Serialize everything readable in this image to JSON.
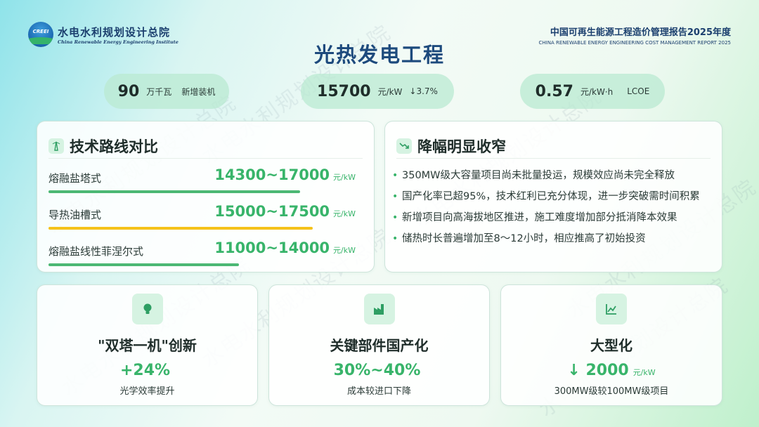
{
  "header": {
    "logo_mark": "CREEI",
    "org_cn": "水电水利规划设计总院",
    "org_en": "China Renewable Energy Engineering Institute",
    "report_cn": "中国可再生能源工程造价管理报告2025年度",
    "report_en": "CHINA RENEWABLE ENERGY ENGINEERING COST MANAGEMENT REPORT 2025"
  },
  "title": "光热发电工程",
  "watermark": "水电水利规划设计总院",
  "kpis": [
    {
      "value": "90",
      "unit": "万千瓦",
      "label": "新增装机"
    },
    {
      "value": "15700",
      "unit": "元/kW",
      "label": "↓3.7%"
    },
    {
      "value": "0.57",
      "unit": "元/kW·h",
      "label": "LCOE"
    }
  ],
  "tech": {
    "icon": "tower-icon",
    "title": "技术路线对比",
    "rows": [
      {
        "name": "熔融盐塔式",
        "range": "14300~17000",
        "unit": "元/kW",
        "bar_color": "#4cb874",
        "bar_fraction": 0.82
      },
      {
        "name": "导热油槽式",
        "range": "15000~17500",
        "unit": "元/kW",
        "bar_color": "#f5c21a",
        "bar_fraction": 0.86
      },
      {
        "name": "熔融盐线性菲涅尔式",
        "range": "11000~14000",
        "unit": "元/kW",
        "bar_color": "#4cb874",
        "bar_fraction": 0.62
      }
    ]
  },
  "decline": {
    "icon": "trend-down-icon",
    "title": "降幅明显收窄",
    "bullets": [
      "350MW级大容量项目尚未批量投运，规模效应尚未完全释放",
      "国产化率已超95%，技术红利已充分体现，进一步突破需时间积累",
      "新增项目向高海拔地区推进，施工难度增加部分抵消降本效果",
      "储热时长普遍增加至8～12小时，相应推高了初始投资"
    ]
  },
  "highlights": [
    {
      "icon": "lightbulb-icon",
      "title": "\"双塔一机\"创新",
      "value": "+24%",
      "unit": "",
      "desc": "光学效率提升"
    },
    {
      "icon": "factory-icon",
      "title": "关键部件国产化",
      "value": "30%~40%",
      "unit": "",
      "desc": "成本较进口下降"
    },
    {
      "icon": "line-chart-icon",
      "title": "大型化",
      "value": "↓ 2000",
      "unit": "元/kW",
      "desc": "300MW级较100MW级项目"
    }
  ]
}
